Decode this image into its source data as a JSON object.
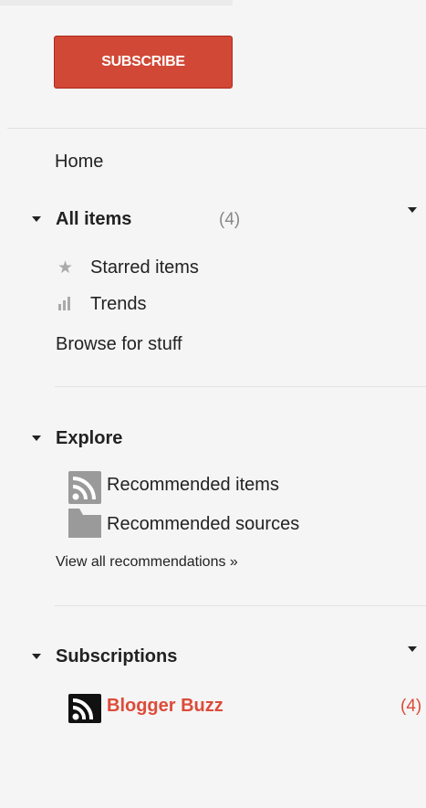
{
  "subscribe": {
    "label": "SUBSCRIBE"
  },
  "nav": {
    "home": "Home",
    "all_items": {
      "label": "All items",
      "count": "(4)"
    },
    "starred": "Starred items",
    "trends": "Trends",
    "browse": "Browse for stuff"
  },
  "explore": {
    "title": "Explore",
    "recommended_items": "Recommended items",
    "recommended_sources": "Recommended sources",
    "view_all": "View all recommendations »"
  },
  "subscriptions": {
    "title": "Subscriptions",
    "feeds": [
      {
        "label": "Blogger Buzz",
        "count": "(4)"
      }
    ]
  },
  "colors": {
    "subscribe_bg": "#d14836",
    "unread_red": "#dd4b39"
  }
}
